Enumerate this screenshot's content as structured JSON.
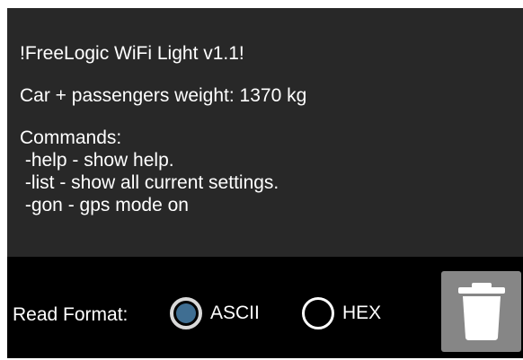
{
  "terminal": {
    "lines": [
      "!FreeLogic WiFi Light v1.1!",
      "",
      "Car + passengers weight: 1370 kg",
      "",
      "Commands:",
      " -help - show help.",
      " -list - show all current settings.",
      " -gon - gps mode on"
    ]
  },
  "controls": {
    "read_format_label": "Read Format:",
    "options": [
      {
        "label": "ASCII",
        "selected": true
      },
      {
        "label": "HEX",
        "selected": false
      }
    ],
    "trash_icon": "trash-icon",
    "selected_color": "#3f6e92"
  }
}
